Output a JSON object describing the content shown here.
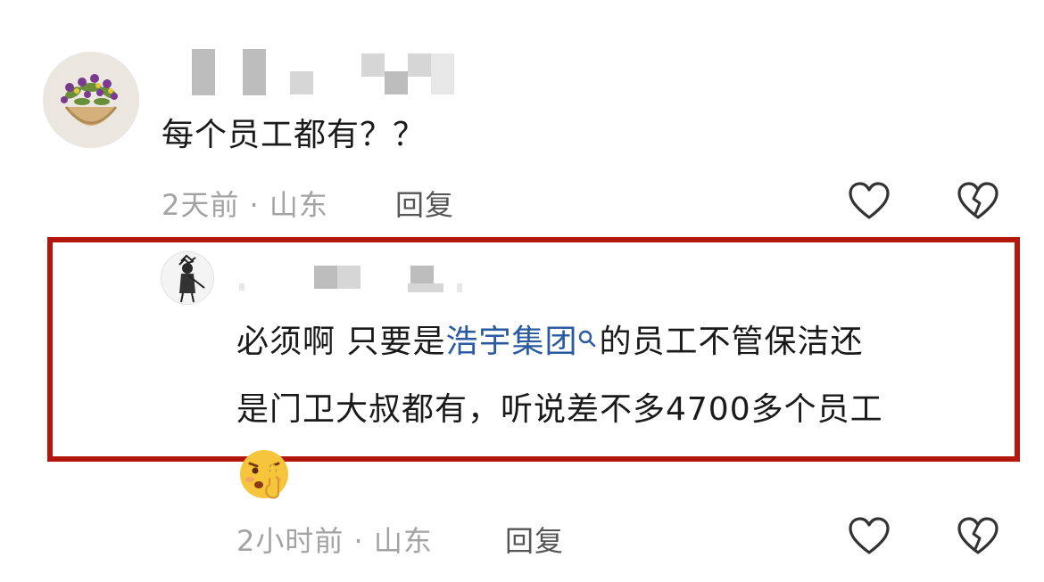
{
  "comment1": {
    "text": "每个员工都有？？",
    "time": "2天前",
    "separator": "·",
    "location": "山东",
    "reply_label": "回复",
    "avatar_icon": "flower-basket-avatar"
  },
  "comment2": {
    "text_before": "必须啊 只要是",
    "link_text": "浩宇集团",
    "text_line1_after": "的员工不管保洁还",
    "text_line2": "是门卫大叔都有，听说差不多4700多个员工",
    "emoji": "shushing-face-emoji",
    "time": "2小时前",
    "separator": "·",
    "location": "山东",
    "reply_label": "回复",
    "avatar_icon": "sketch-figure-avatar"
  },
  "icons": {
    "like": "heart-outline-icon",
    "dislike": "broken-heart-icon",
    "search": "search-icon"
  },
  "colors": {
    "highlight_border": "#b5170f",
    "link": "#2a5aa0",
    "meta_text": "#a3a3a3"
  }
}
